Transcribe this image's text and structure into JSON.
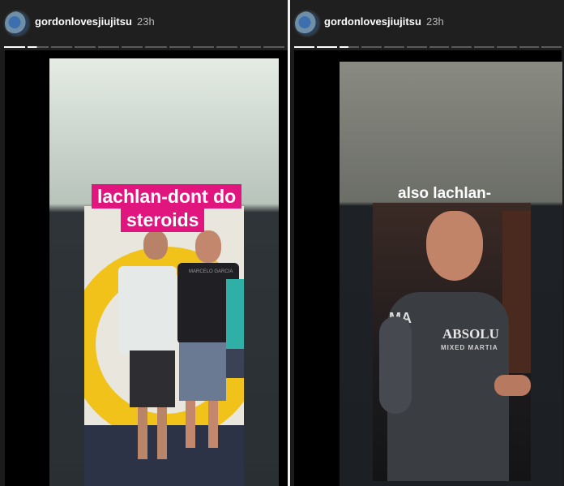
{
  "stories": [
    {
      "username": "gordonlovesjiujitsu",
      "time": "23h",
      "caption_line1": "lachlan-dont do",
      "caption_line2": "steroids",
      "shirt_text": "MARCELO GARCIA"
    },
    {
      "username": "gordonlovesjiujitsu",
      "time": "23h",
      "caption": "also lachlan-",
      "shirt_text_1": "ABSOLU",
      "shirt_text_2": "MIXED MARTIA",
      "sleeve_text": "MA"
    }
  ]
}
